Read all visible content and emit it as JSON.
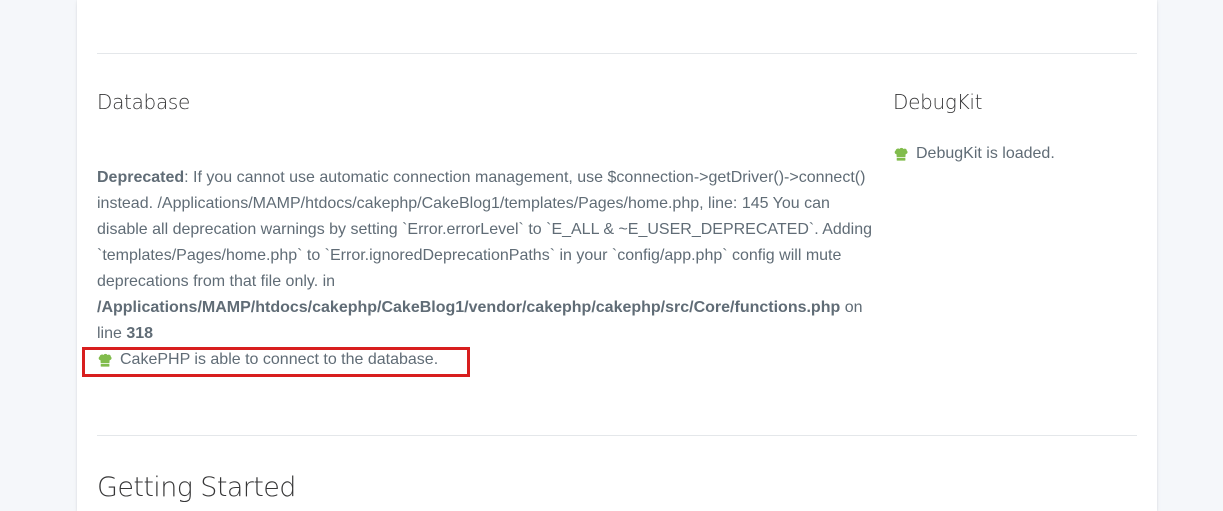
{
  "database": {
    "heading": "Database",
    "deprecation": {
      "label": "Deprecated",
      "message": ": If you cannot use automatic connection management, use $connection->getDriver()->connect() instead. /Applications/MAMP/htdocs/cakephp/CakeBlog1/templates/Pages/home.php, line: 145 You can disable all deprecation warnings by setting `Error.errorLevel` to `E_ALL & ~E_USER_DEPRECATED`. Adding `templates/Pages/home.php` to `Error.ignoredDeprecationPaths` in your `config/app.php` config will mute deprecations from that file only. in ",
      "file": "/Applications/MAMP/htdocs/cakephp/CakeBlog1/vendor/cakephp/cakephp/src/Core/functions.php",
      "on_line_text": " on line ",
      "line_number": "318"
    },
    "success_message": "CakePHP is able to connect to the database.",
    "icon": "chef-hat-icon"
  },
  "debugkit": {
    "heading": "DebugKit",
    "status_message": "DebugKit is loaded.",
    "icon": "chef-hat-icon"
  },
  "getting_started": {
    "heading": "Getting Started"
  },
  "colors": {
    "success_icon": "#81bc4c",
    "highlight_border": "#d81e1e",
    "text": "#606c76",
    "heading": "#363637"
  }
}
